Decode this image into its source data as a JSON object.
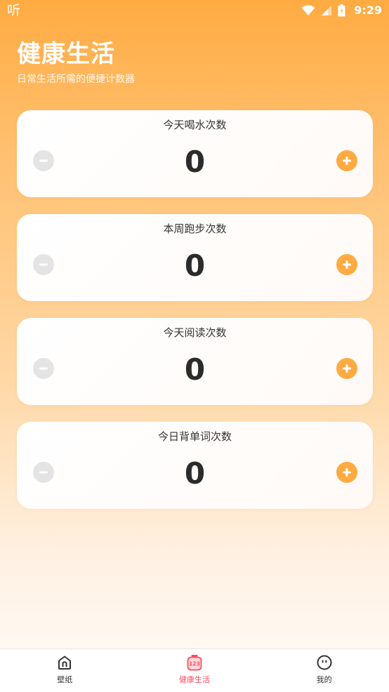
{
  "status_bar": {
    "app_indicator": "听",
    "time": "9:29",
    "icons": [
      "wifi-icon",
      "signal-icon",
      "battery-icon"
    ]
  },
  "header": {
    "title": "健康生活",
    "subtitle": "日常生活所需的便捷计数器"
  },
  "counters": [
    {
      "title": "今天喝水次数",
      "count": "0"
    },
    {
      "title": "本周跑步次数",
      "count": "0"
    },
    {
      "title": "今天阅读次数",
      "count": "0"
    },
    {
      "title": "今日背单词次数",
      "count": "0"
    }
  ],
  "bottom_nav": {
    "items": [
      {
        "label": "壁纸",
        "icon": "wallpaper-home-icon",
        "active": false
      },
      {
        "label": "健康生活",
        "icon": "counter-123-icon",
        "active": true
      },
      {
        "label": "我的",
        "icon": "face-profile-icon",
        "active": false
      }
    ]
  },
  "colors": {
    "accent": "#ffab42",
    "active_tab": "#ff4d5e",
    "minus_button": "#e4e4e4"
  }
}
